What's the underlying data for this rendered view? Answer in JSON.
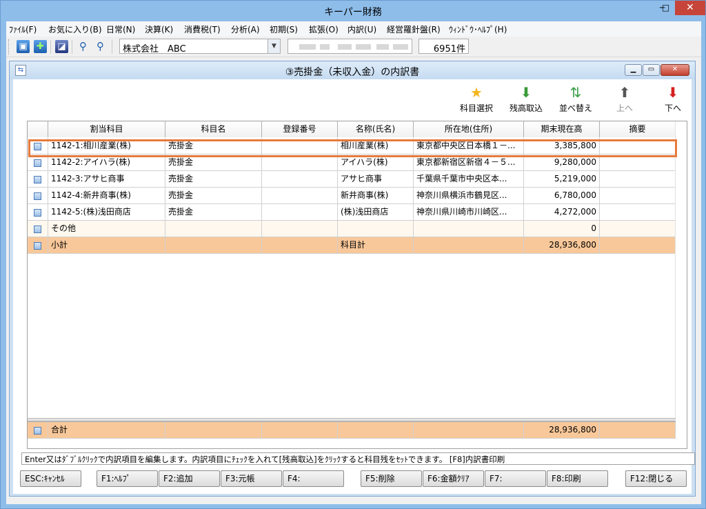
{
  "window": {
    "title": "キーパー財務",
    "min_label": "─",
    "max_label": "□",
    "close_label": "✕"
  },
  "menu": [
    "ﾌｧｲﾙ(F)",
    "お気に入り(B)",
    "日常(N)",
    "決算(K)",
    "消費税(T)",
    "分析(A)",
    "初期(S)",
    "拡張(O)",
    "内訳(U)",
    "経営羅針盤(R)",
    "ｳｨﾝﾄﾞｳ･ﾍﾙﾌﾟ(H)"
  ],
  "toolbar": {
    "company": "株式会社　ABC",
    "count": "6951件",
    "icons": [
      "screen-icon",
      "screen-add-icon",
      "monitor-icon",
      "zoom-in-icon",
      "zoom-out-icon"
    ]
  },
  "child": {
    "title": "③売掛金（未収入金）の内訳書",
    "icon_glyph": "⇆"
  },
  "actions": {
    "select_subject": "科目選択",
    "import_balance": "残高取込",
    "sort": "並べ替え",
    "up": "上へ",
    "down": "下へ"
  },
  "table": {
    "columns": [
      "",
      "割当科目",
      "科目名",
      "登録番号",
      "名称(氏名)",
      "所在地(住所)",
      "期末現在高",
      "摘要"
    ],
    "rows": [
      {
        "assign": "1142-1:相川産業(株)",
        "subject": "売掛金",
        "reg": "",
        "name": "相川産業(株)",
        "addr": "東京都中央区日本橋１－...",
        "amount": "3,385,800",
        "note": ""
      },
      {
        "assign": "1142-2:アイハラ(株)",
        "subject": "売掛金",
        "reg": "",
        "name": "アイハラ(株)",
        "addr": "東京都新宿区新宿４－５...",
        "amount": "9,280,000",
        "note": ""
      },
      {
        "assign": "1142-3:アサヒ商事",
        "subject": "売掛金",
        "reg": "",
        "name": "アサヒ商事",
        "addr": "千葉県千葉市中央区本...",
        "amount": "5,219,000",
        "note": ""
      },
      {
        "assign": "1142-4:新井商事(株)",
        "subject": "売掛金",
        "reg": "",
        "name": "新井商事(株)",
        "addr": "神奈川県横浜市鶴見区...",
        "amount": "6,780,000",
        "note": ""
      },
      {
        "assign": "1142-5:(株)浅田商店",
        "subject": "売掛金",
        "reg": "",
        "name": "(株)浅田商店",
        "addr": "神奈川県川崎市川崎区...",
        "amount": "4,272,000",
        "note": ""
      }
    ],
    "other": {
      "assign": "その他",
      "amount": "0"
    },
    "subtotal": {
      "assign": "小計",
      "name": "科目計",
      "amount": "28,936,800"
    },
    "total": {
      "assign": "合計",
      "amount": "28,936,800"
    }
  },
  "status": "Enter又はﾀﾞﾌﾞﾙｸﾘｯｸで内訳項目を編集します。内訳項目にﾁｪｯｸを入れて[残高取込]をｸﾘｯｸすると科目残をｾｯﾄできます。 [F8]内訳書印刷",
  "fkeys": [
    "ESC:ｷｬﾝｾﾙ",
    "F1:ﾍﾙﾌﾟ",
    "F2:追加",
    "F3:元帳",
    "F4:",
    "F5:削除",
    "F6:金額ｸﾘｱ",
    "F7:",
    "F8:印刷",
    "F12:閉じる"
  ]
}
